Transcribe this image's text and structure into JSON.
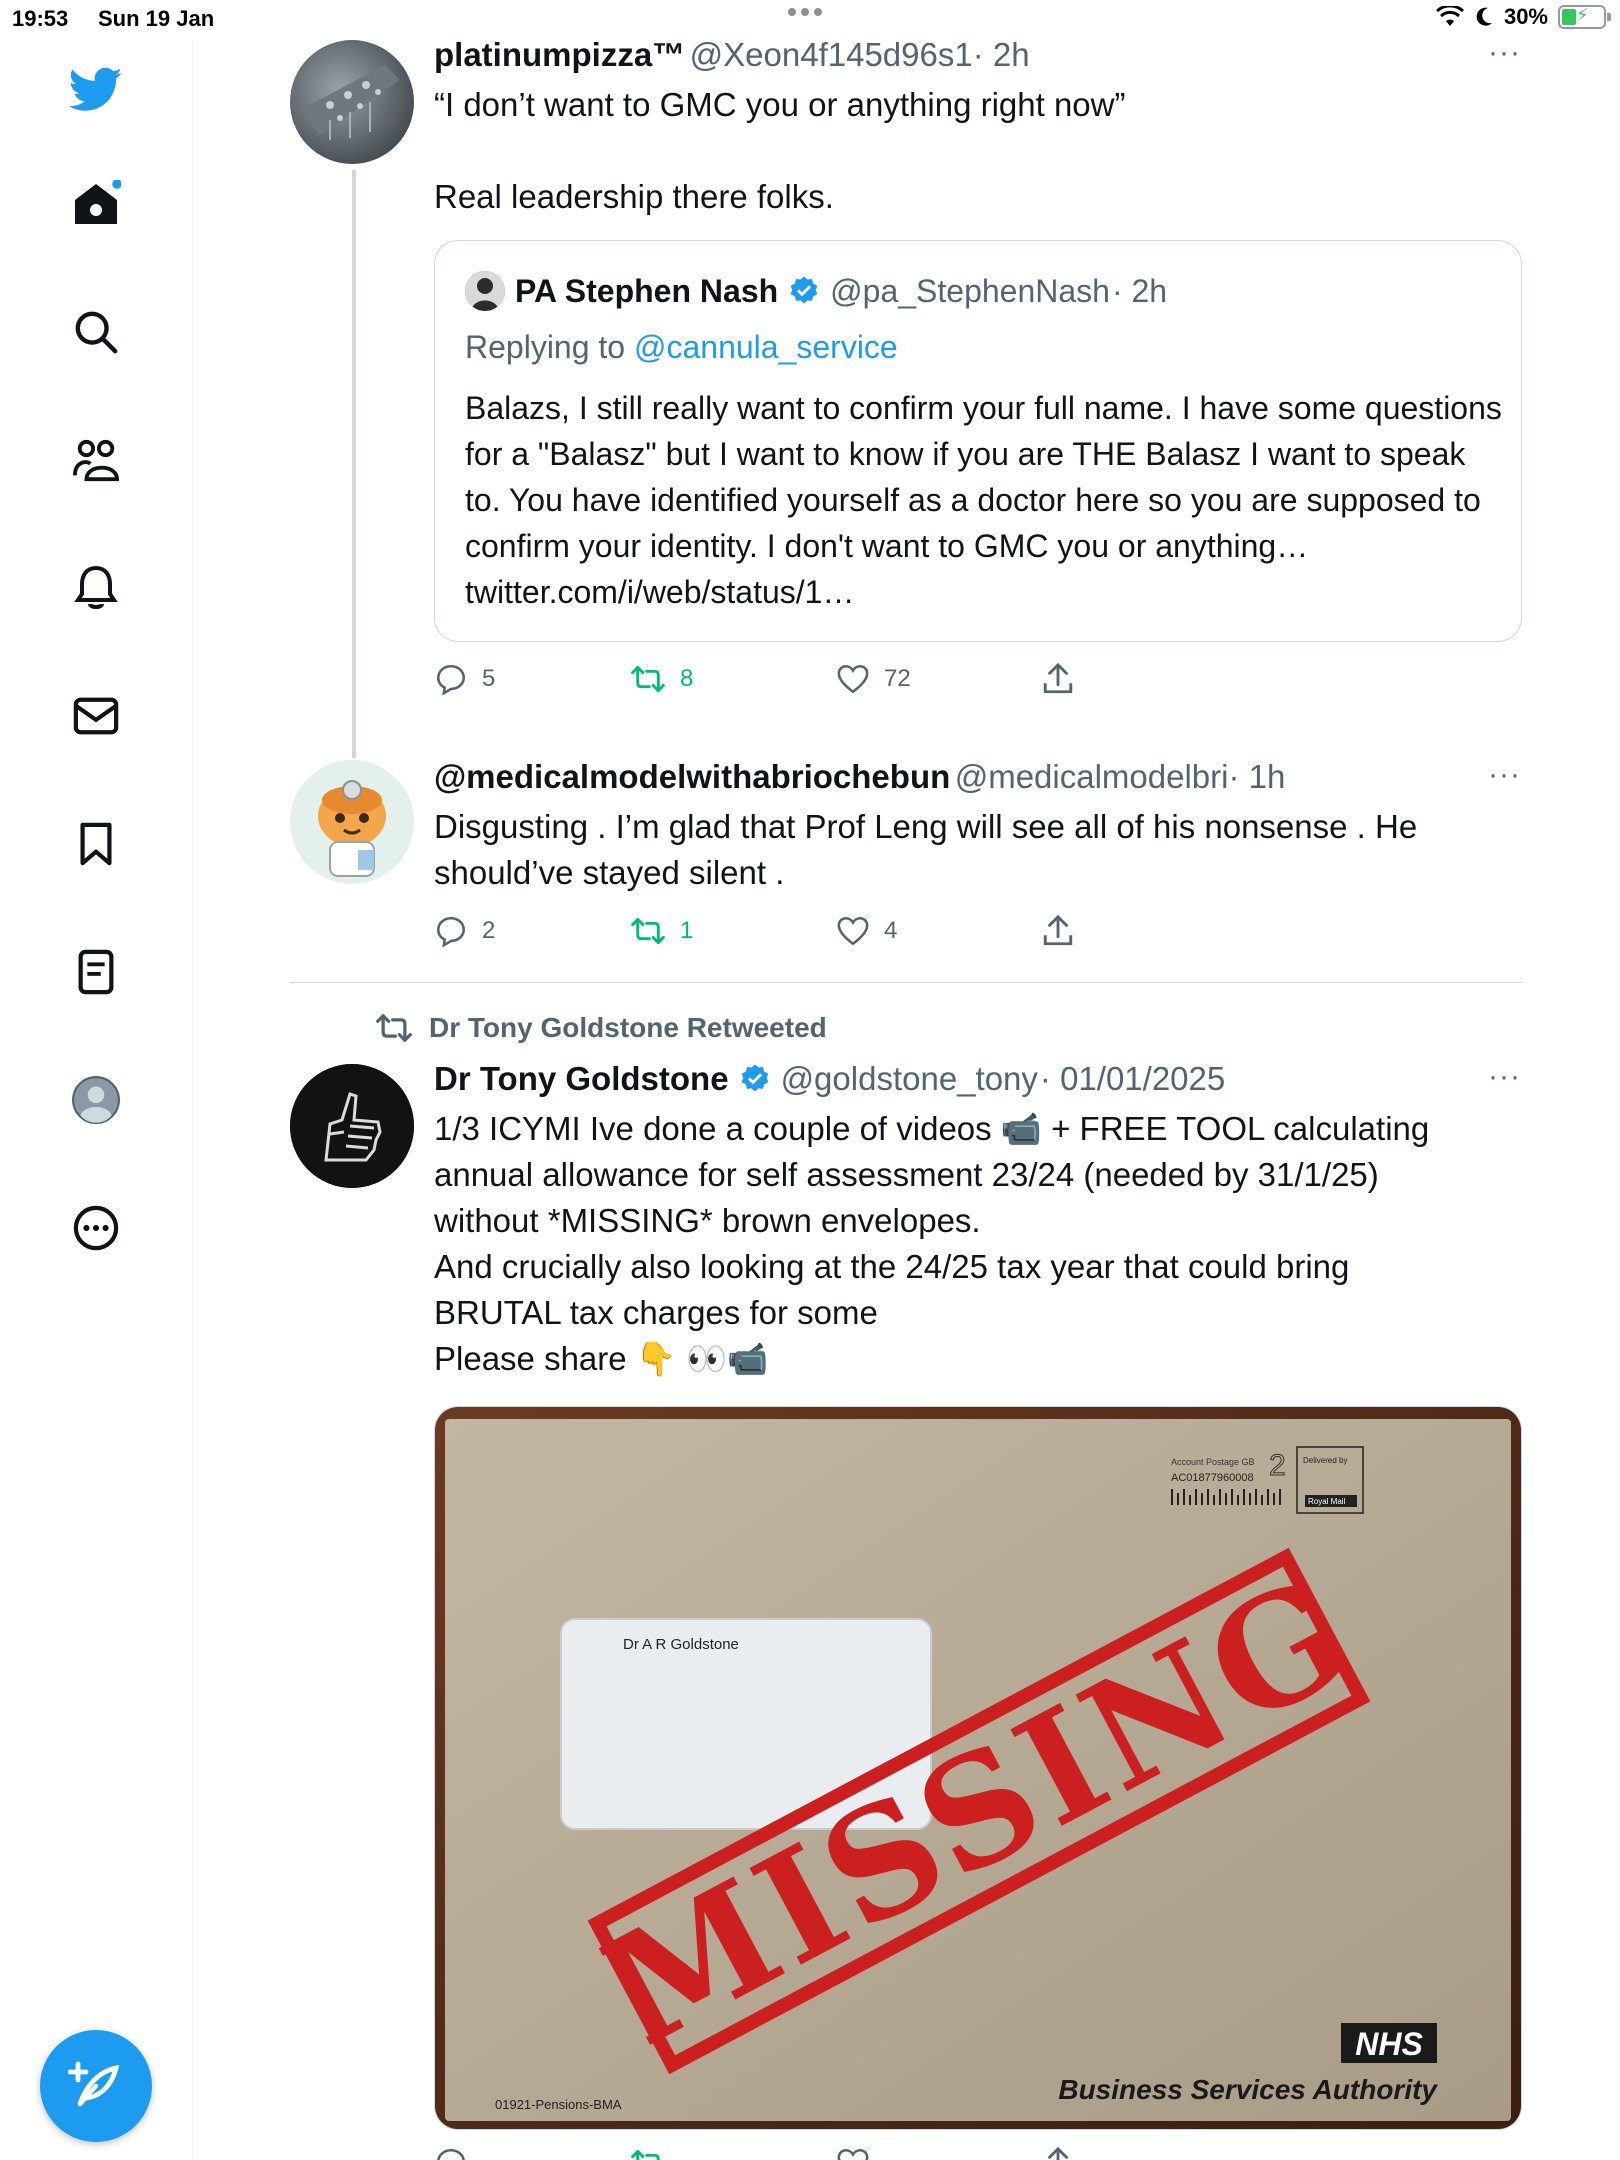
{
  "status_bar": {
    "time": "19:53",
    "date": "Sun 19 Jan",
    "battery": "30%"
  },
  "sidebar": {
    "items": [
      {
        "icon": "twitter-logo-icon"
      },
      {
        "icon": "home-icon"
      },
      {
        "icon": "search-icon"
      },
      {
        "icon": "communities-icon"
      },
      {
        "icon": "notifications-bell-icon"
      },
      {
        "icon": "messages-envelope-icon"
      },
      {
        "icon": "bookmark-icon"
      },
      {
        "icon": "lists-icon"
      },
      {
        "icon": "profile-icon"
      },
      {
        "icon": "more-circle-icon"
      }
    ],
    "compose_icon": "compose-feather-icon"
  },
  "tweets": [
    {
      "name": "platinumpizza™",
      "handle": "@Xeon4f145d96s1",
      "time": "· 2h",
      "text_line1": "“I don’t want to GMC you or anything right now”",
      "text_line2": "Real leadership there folks.",
      "quote": {
        "name": "PA Stephen Nash",
        "handle": "@pa_StephenNash",
        "time": "· 2h",
        "replying_prefix": "Replying to",
        "replying_to": "@cannula_service",
        "text": "Balazs, I still really want to confirm your full name. I have some questions for a \"Balasz\" but I want to know if you are THE Balasz I want to speak to. You have identified yourself as a doctor here so you are supposed to confirm your identity. I don't want to GMC you or anything… twitter.com/i/web/status/1…"
      },
      "replies": "5",
      "retweets": "8",
      "likes": "72"
    },
    {
      "name": "@medicalmodelwithabriochebun",
      "handle": "@medicalmodelbri",
      "time": "· 1h",
      "text": "Disgusting . I’m glad that Prof Leng will see all of his nonsense . He should’ve stayed silent .",
      "replies": "2",
      "retweets": "1",
      "likes": "4"
    },
    {
      "retweeted_by": "Dr Tony Goldstone Retweeted",
      "name": "Dr Tony Goldstone",
      "handle": "@goldstone_tony",
      "time": "· 01/01/2025",
      "text_lines": [
        "1/3 ICYMI Ive done a couple of videos 📹 + FREE TOOL calculating",
        "annual allowance for self assessment 23/24 (needed by 31/1/25)",
        "without *MISSING* brown envelopes.",
        "And crucially also looking at the 24/25 tax year that could bring",
        "BRUTAL tax charges for some",
        "Please share  👇 👀📹"
      ],
      "image": {
        "postage_label": "Account Postage GB",
        "postage_code": "AC01877960008",
        "postage_class": "2",
        "delivered_by": "Delivered by",
        "royal_mail": "Royal Mail",
        "window_name": "Dr A R Goldstone",
        "stamp_text": "MISSING",
        "nhs": "NHS",
        "authority": "Business Services Authority",
        "ref": "01921-Pensions-BMA"
      }
    }
  ],
  "colors": {
    "accent": "#1d9bf0",
    "retweet": "#00ba7c",
    "muted": "#536471",
    "border": "#cfd9de",
    "stamp_red": "#cc1f1f",
    "envelope": "#b7aa95"
  }
}
